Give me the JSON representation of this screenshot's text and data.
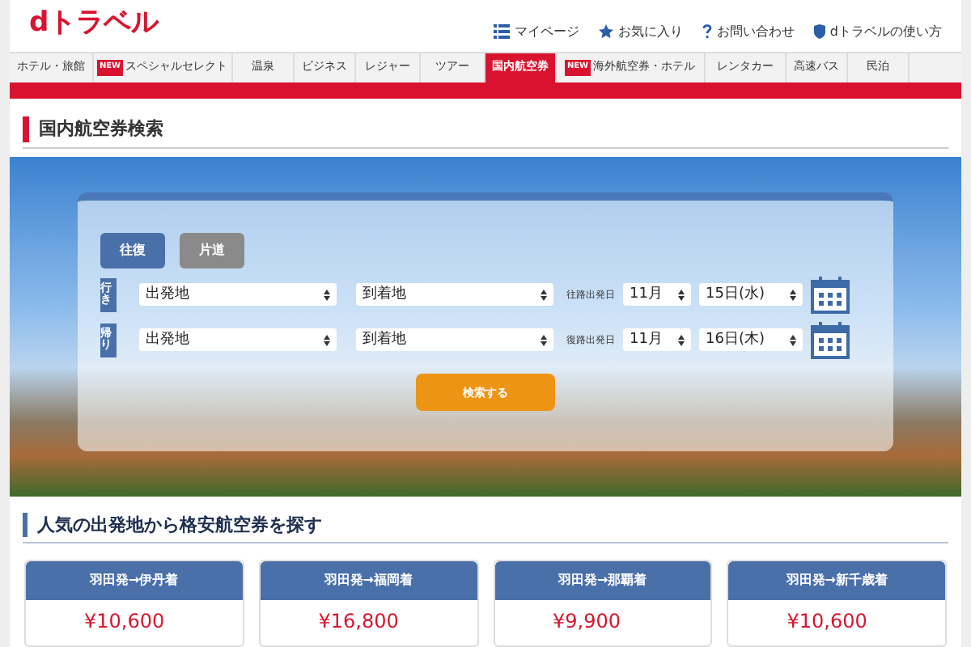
{
  "header": {
    "logo": "dトラベル",
    "links": [
      {
        "label": "マイページ",
        "kind": "list"
      },
      {
        "label": "お気に入り",
        "kind": "star"
      },
      {
        "label": "お問い合わせ",
        "kind": "question"
      },
      {
        "label": "dトラベルの使い方",
        "kind": "shield"
      }
    ]
  },
  "nav": [
    {
      "label": "ホテル・旅館",
      "selected": false
    },
    {
      "label": "スペシャルセレクト",
      "selected": false,
      "badge": "NEW"
    },
    {
      "label": "温泉",
      "selected": false
    },
    {
      "label": "ビジネス",
      "selected": false
    },
    {
      "label": "レジャー",
      "selected": false
    },
    {
      "label": "ツアー",
      "selected": false
    },
    {
      "label": "国内航空券",
      "selected": true
    },
    {
      "label": "海外航空券・ホテル",
      "selected": false,
      "badge": "NEW"
    },
    {
      "label": "レンタカー",
      "selected": false
    },
    {
      "label": "高速バス",
      "selected": false
    },
    {
      "label": "民泊",
      "selected": false
    }
  ],
  "search_title": "国内航空券検索",
  "trip_types": [
    {
      "label": "往復",
      "selected": true
    },
    {
      "label": "片道",
      "selected": false
    }
  ],
  "legs": [
    {
      "label": "行き",
      "from": "出発地",
      "to": "到着地",
      "date_label": "往路出発日",
      "month": "11月",
      "day": "15日(水)"
    },
    {
      "label": "帰り",
      "from": "出発地",
      "to": "到着地",
      "date_label": "復路出発日",
      "month": "11月",
      "day": "16日(木)"
    }
  ],
  "search_button": "検索する",
  "popular_title": "人気の出発地から格安航空券を探す",
  "routes": [
    {
      "title": "羽田発→伊丹着",
      "price": "¥10,600"
    },
    {
      "title": "羽田発→福岡着",
      "price": "¥16,800"
    },
    {
      "title": "羽田発→那覇着",
      "price": "¥9,900"
    },
    {
      "title": "羽田発→新千歳着",
      "price": "¥10,600"
    }
  ]
}
